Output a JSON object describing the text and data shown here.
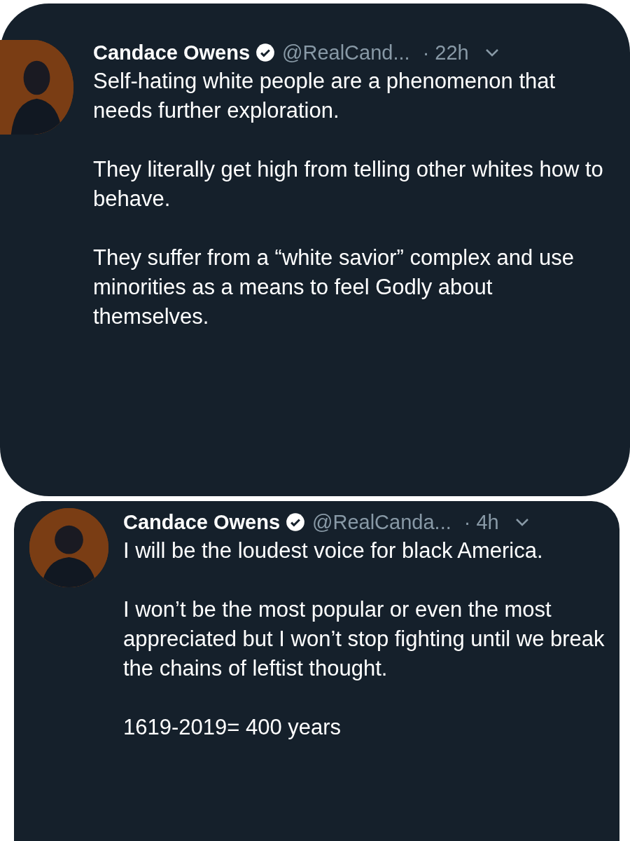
{
  "tweets": [
    {
      "name": "Candace Owens",
      "verified": true,
      "handle": "@RealCand...",
      "time": "· 22h",
      "paragraphs": [
        "Self-hating white people are a phenomenon that needs further exploration.",
        "They literally get high from telling other whites how to behave.",
        "They suffer from a “white savior” complex and use minorities as a means to feel Godly about themselves."
      ]
    },
    {
      "name": "Candace Owens",
      "verified": true,
      "handle": "@RealCanda...",
      "time": "· 4h",
      "paragraphs": [
        "I will be the loudest voice for black America.",
        "I won’t be the most popular or even the most appreciated but I won’t stop fighting until we break the chains of leftist thought.",
        "1619-2019= 400 years"
      ]
    }
  ]
}
